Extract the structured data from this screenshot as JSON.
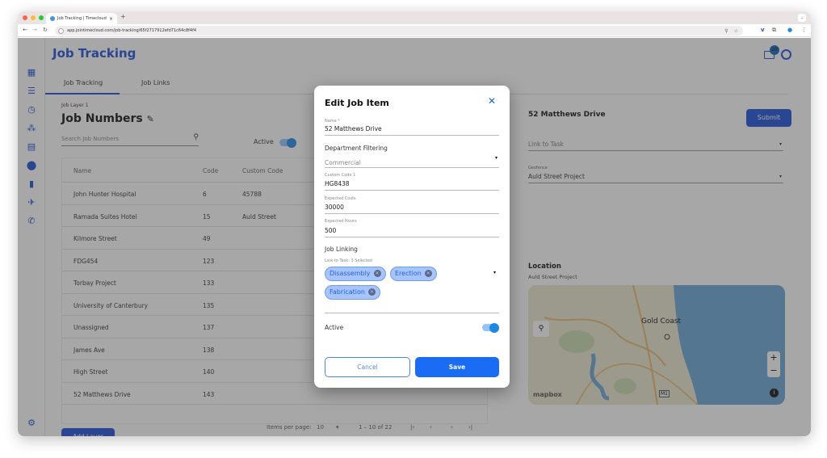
{
  "browser": {
    "tab_title": "Job Tracking | Timecloud",
    "url": "app.jointimecloud.com/job-tracking/65f2717912efd71c64c8f4f4"
  },
  "header": {
    "title": "Job Tracking",
    "notification_count": "20"
  },
  "sidebar": {
    "items": [
      {
        "icon": "dashboard-icon"
      },
      {
        "icon": "list-icon"
      },
      {
        "icon": "clock-icon"
      },
      {
        "icon": "group-icon"
      },
      {
        "icon": "calendar-icon"
      },
      {
        "icon": "location-pin-icon"
      },
      {
        "icon": "document-icon"
      },
      {
        "icon": "flight-departure-icon"
      },
      {
        "icon": "phone-forwarded-icon"
      }
    ],
    "settings_icon": "gear-icon"
  },
  "tabs": [
    {
      "label": "Job Tracking",
      "active": true
    },
    {
      "label": "Job Links",
      "active": false
    }
  ],
  "job_panel": {
    "layer_label": "Job Layer 1",
    "title": "Job Numbers",
    "search_placeholder": "Search Job Numbers",
    "active_label": "Active",
    "active_on": true,
    "columns": [
      "Name",
      "Code",
      "Custom Code"
    ],
    "rows": [
      {
        "name": "John Hunter Hospital",
        "code": "6",
        "custom": "45788"
      },
      {
        "name": "Ramada Suites Hotel",
        "code": "15",
        "custom": "Auld Street"
      },
      {
        "name": "Kilmore Street",
        "code": "49",
        "custom": ""
      },
      {
        "name": "FDG454",
        "code": "123",
        "custom": ""
      },
      {
        "name": "Torbay Project",
        "code": "133",
        "custom": ""
      },
      {
        "name": "University of Canterbury",
        "code": "135",
        "custom": ""
      },
      {
        "name": "Unassigned",
        "code": "137",
        "custom": ""
      },
      {
        "name": "James Ave",
        "code": "138",
        "custom": ""
      },
      {
        "name": "High Street",
        "code": "140",
        "custom": ""
      },
      {
        "name": "52 Matthews Drive",
        "code": "143",
        "custom": ""
      }
    ],
    "pager": {
      "items_per_page_label": "Items per page:",
      "items_per_page": "10",
      "range": "1 – 10 of 22"
    },
    "add_layer_label": "Add Layer"
  },
  "detail_panel": {
    "title": "52 Matthews Drive",
    "submit_label": "Submit",
    "link_to_task_placeholder": "Link to Task",
    "geofence_label": "Geofence",
    "geofence_value": "Auld Street Project"
  },
  "location_panel": {
    "title": "Location",
    "subtitle": "Auld Street Project",
    "map_label": "Gold Coast",
    "map_attribution": "mapbox",
    "road_label": "M1",
    "zoom_in": "+",
    "zoom_out": "−"
  },
  "modal": {
    "title": "Edit Job Item",
    "fields": {
      "name_label": "Name *",
      "name_value": "52 Matthews Drive",
      "dept_section": "Department Filtering",
      "dept_value": "Commercial",
      "custom_code_label": "Custom Code 1",
      "custom_code_value": "HG8438",
      "costs_label": "Expected Costs",
      "costs_value": "30000",
      "hours_label": "Expected Hours",
      "hours_value": "500",
      "linking_section": "Job Linking",
      "link_label": "Link to Task: 3 Selected",
      "chips": [
        "Disassembly",
        "Erection",
        "Fabrication"
      ],
      "active_label": "Active",
      "active_on": true
    },
    "cancel_label": "Cancel",
    "save_label": "Save"
  }
}
